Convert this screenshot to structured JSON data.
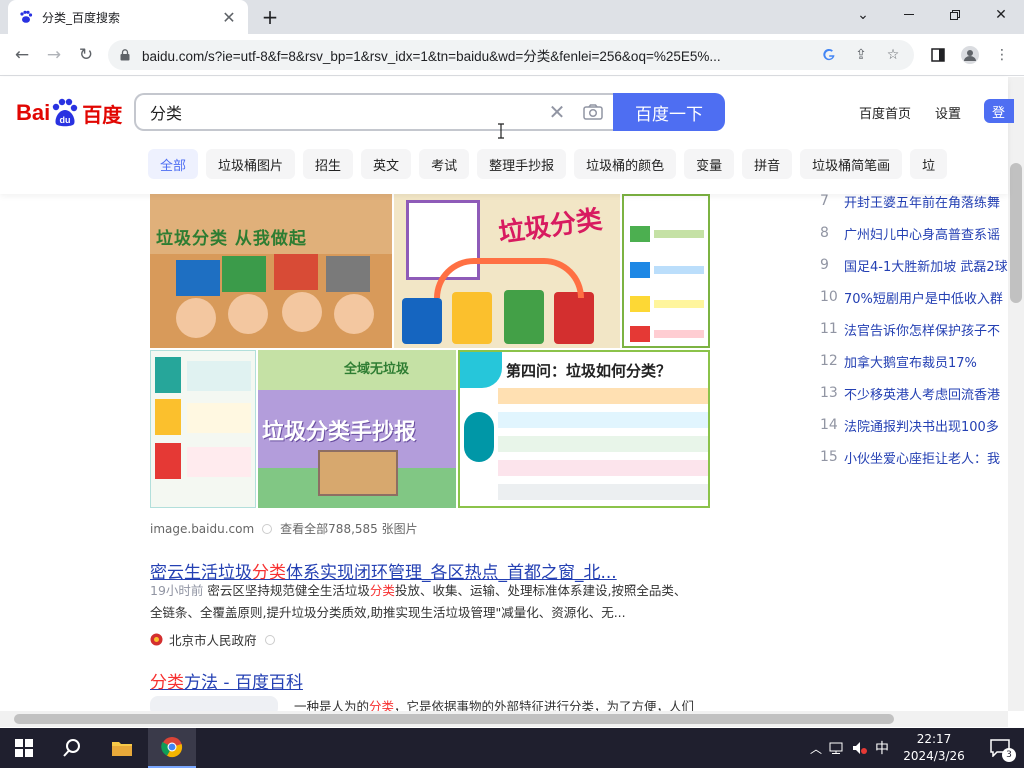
{
  "browser": {
    "tab_title": "分类_百度搜索",
    "new_tab": "+",
    "url": "baidu.com/s?ie=utf-8&f=8&rsv_bp=1&rsv_idx=1&tn=baidu&wd=分类&fenlei=256&oq=%25E5%..."
  },
  "header": {
    "logo_bai": "Bai",
    "logo_du": "du",
    "logo_cn": "百度",
    "query": "分类",
    "search_button": "百度一下",
    "home_link": "百度首页",
    "settings_link": "设置",
    "login_button": "登"
  },
  "tabs": [
    {
      "label": "全部"
    },
    {
      "label": "垃圾桶图片"
    },
    {
      "label": "招生"
    },
    {
      "label": "英文"
    },
    {
      "label": "考试"
    },
    {
      "label": "整理手抄报"
    },
    {
      "label": "垃圾桶的颜色"
    },
    {
      "label": "变量"
    },
    {
      "label": "拼音"
    },
    {
      "label": "垃圾桶简笔画"
    },
    {
      "label": "垃"
    }
  ],
  "images": {
    "tile1_text": "垃圾分类  从我做起",
    "tile2_text": "垃圾分类",
    "tile5_text": "垃圾分类手抄报",
    "tile5_top": "全域无垃圾",
    "tile6_text": "第四问：垃圾如何分类？",
    "source": "image.baidu.com",
    "view_all": "查看全部788,585 张图片"
  },
  "result1": {
    "title_pre": "密云生活垃圾",
    "title_hl": "分类",
    "title_post": "体系实现闭环管理_各区热点_首都之窗_北...",
    "time": "19小时前",
    "abs_line1_pre": "密云区坚持规范健全生活垃圾",
    "abs_hl": "分类",
    "abs_line1_post": "投放、收集、运输、处理标准体系建设,按照全品类、",
    "abs_line2": "全链条、全覆盖原则,提升垃圾分类质效,助推实现生活垃圾管理\"减量化、资源化、无...",
    "source": "北京市人民政府"
  },
  "result2": {
    "title_hl": "分类",
    "title_post": "方法 - 百度百科",
    "abs_pre": "一种是人为的",
    "abs_hl": "分类",
    "abs_post": "，它是依据事物的外部特征进行分类，为了方便，人们"
  },
  "hot": [
    {
      "num": "7",
      "text": "开封王婆五年前在角落练舞"
    },
    {
      "num": "8",
      "text": "广州妇儿中心身高普查系谣"
    },
    {
      "num": "9",
      "text": "国足4-1大胜新加坡 武磊2球"
    },
    {
      "num": "10",
      "text": "70%短剧用户是中低收入群"
    },
    {
      "num": "11",
      "text": "法官告诉你怎样保护孩子不"
    },
    {
      "num": "12",
      "text": "加拿大鹅宣布裁员17%"
    },
    {
      "num": "13",
      "text": "不少移英港人考虑回流香港"
    },
    {
      "num": "14",
      "text": "法院通报判决书出现100多"
    },
    {
      "num": "15",
      "text": "小伙坐爱心座拒让老人：我"
    }
  ],
  "taskbar": {
    "time": "22:17",
    "date": "2024/3/26",
    "ime": "中",
    "notification_count": "3"
  },
  "colors": {
    "baidu_blue": "#4e6ef2",
    "link_blue": "#2440b3",
    "highlight_red": "#f73131",
    "logo_red": "#e10602"
  }
}
